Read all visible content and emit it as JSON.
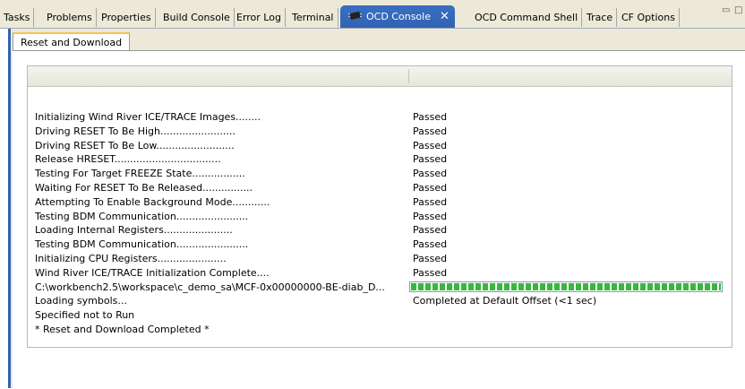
{
  "tabs": [
    {
      "label": "Tasks"
    },
    {
      "label": "Problems"
    },
    {
      "label": "Properties"
    },
    {
      "label": "Build Console"
    },
    {
      "label": "Error Log"
    },
    {
      "label": "Terminal"
    },
    {
      "label": "OCD Console",
      "active": true,
      "icon": "chip-icon"
    },
    {
      "label": "OCD Command Shell"
    },
    {
      "label": "Trace"
    },
    {
      "label": "CF Options"
    }
  ],
  "window_controls": {
    "minimize_icon": "minimize-icon",
    "maximize_icon": "maximize-icon"
  },
  "subtab": {
    "label": "Reset and Download"
  },
  "steps": [
    {
      "step": "Initializing Wind River ICE/TRACE Images........",
      "status": "Passed"
    },
    {
      "step": "Driving RESET To Be High........................",
      "status": "Passed"
    },
    {
      "step": "Driving RESET To Be Low.........................",
      "status": "Passed"
    },
    {
      "step": "Release HRESET..................................",
      "status": "Passed"
    },
    {
      "step": "Testing For Target FREEZE State.................",
      "status": "Passed"
    },
    {
      "step": "Waiting For RESET To Be Released................",
      "status": "Passed"
    },
    {
      "step": "Attempting To Enable Background Mode............",
      "status": "Passed"
    },
    {
      "step": "Testing BDM Communication.......................",
      "status": "Passed"
    },
    {
      "step": "Loading Internal Registers......................",
      "status": "Passed"
    },
    {
      "step": "Testing BDM Communication.......................",
      "status": "Passed"
    },
    {
      "step": "Initializing CPU Registers......................",
      "status": "Passed"
    },
    {
      "step": "Wind River ICE/TRACE Initialization Complete....",
      "status": "Passed"
    }
  ],
  "download": {
    "path": "C:\\workbench2.5\\workspace\\c_demo_sa\\MCF-0x00000000-BE-diab_D...",
    "progress": 1.0
  },
  "symbols": {
    "label": "Loading symbols...",
    "status": "Completed at Default Offset (<1 sec)"
  },
  "not_run": "Specified not to Run",
  "completed": "* Reset and Download Completed *",
  "colors": {
    "accent": "#3162b3",
    "progress": "#37b83a",
    "subtab_highlight": "#f5c455"
  }
}
